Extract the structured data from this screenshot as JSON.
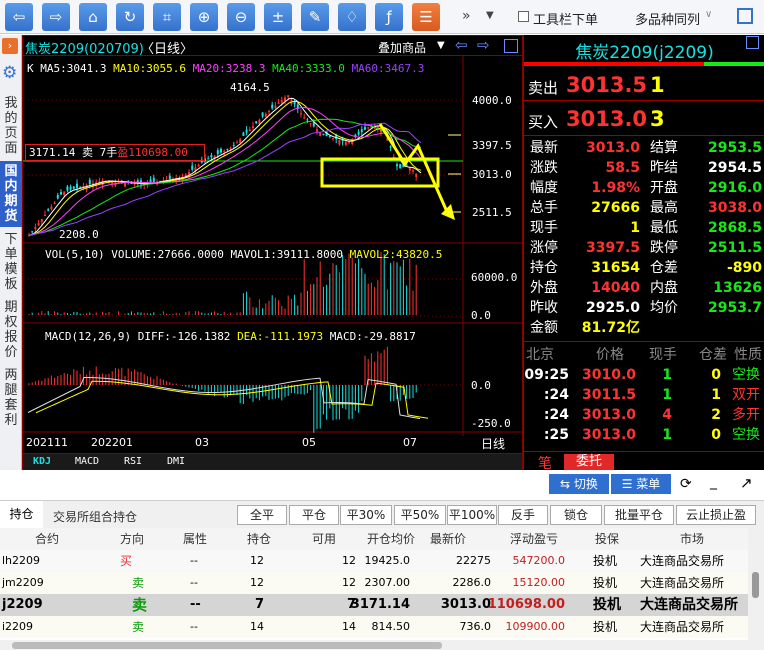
{
  "toolbar": {
    "icons": [
      "back",
      "forward",
      "home",
      "refresh",
      "crop",
      "zoom-in",
      "zoom-out",
      "calculator",
      "pencil",
      "bell",
      "formula",
      "list"
    ],
    "more": "»",
    "checkbox_label": "工具栏下单",
    "multi_label": "多品种同列"
  },
  "sidebar": {
    "items": [
      "我的页面",
      "国内期货",
      "下单模板",
      "期权报价",
      "两腿套利"
    ],
    "active": 1
  },
  "chart": {
    "title": "焦炭2209(020709)",
    "period": "〈日线〉",
    "overlay": "叠加商品",
    "ma_legend": {
      "k": "K",
      "ma5": "MA5:3041.3",
      "ma10": "MA10:3055.6",
      "ma20": "MA20:3238.3",
      "ma40": "MA40:3333.0",
      "ma60": "MA60:3467.3"
    },
    "high_label": "4164.5",
    "low_label": "2208.0",
    "position_box": {
      "price": "3171.14",
      "side": "卖",
      "qty": "7手",
      "pnl": "盈110698.00"
    },
    "price_axis": [
      "4000.0",
      "3397.5",
      "3013.0",
      "2511.5"
    ],
    "vol_legend": {
      "name": "VOL(5,10)",
      "volume": "VOLUME:27666.0000",
      "mavol1": "MAVOL1:39111.8000",
      "mavol2": "MAVOL2:43820.5"
    },
    "vol_axis": [
      "60000.0",
      "0.0"
    ],
    "macd_legend": {
      "name": "MACD(12,26,9)",
      "diff": "DIFF:-126.1382",
      "dea": "DEA:-111.1973",
      "macd": "MACD:-29.8817"
    },
    "macd_axis": [
      "0.0",
      "-250.0"
    ],
    "dates": [
      "202111",
      "202201",
      "03",
      "05",
      "07"
    ],
    "period_label": "日线",
    "indicator_tabs": [
      "KDJ",
      "MACD",
      "RSI",
      "DMI"
    ]
  },
  "quote": {
    "title": "焦炭2209(j2209)",
    "ask_label": "卖出",
    "ask_price": "3013.5",
    "ask_vol": "1",
    "bid_label": "买入",
    "bid_price": "3013.0",
    "bid_vol": "3",
    "rows": [
      [
        "最新",
        "3013.0",
        "结算",
        "2953.5"
      ],
      [
        "涨跌",
        "58.5",
        "昨结",
        "2954.5"
      ],
      [
        "幅度",
        "1.98%",
        "开盘",
        "2916.0"
      ],
      [
        "总手",
        "27666",
        "最高",
        "3038.0"
      ],
      [
        "现手",
        "1",
        "最低",
        "2868.5"
      ],
      [
        "涨停",
        "3397.5",
        "跌停",
        "2511.5"
      ],
      [
        "持仓",
        "31654",
        "仓差",
        "-890"
      ],
      [
        "外盘",
        "14040",
        "内盘",
        "13626"
      ],
      [
        "昨收",
        "2925.0",
        "均价",
        "2953.7"
      ],
      [
        "金额",
        "81.72亿",
        "",
        ""
      ]
    ],
    "tick_headers": [
      "北京",
      "价格",
      "现手",
      "仓差",
      "性质"
    ],
    "ticks": [
      [
        "09:25",
        "3010.0",
        "1",
        "0",
        "空换"
      ],
      [
        ":24",
        "3011.5",
        "1",
        "1",
        "双开"
      ],
      [
        ":24",
        "3013.0",
        "4",
        "2",
        "多开"
      ],
      [
        ":25",
        "3013.0",
        "1",
        "0",
        "空换"
      ]
    ],
    "tabs": [
      "笔",
      "委托"
    ]
  },
  "panel": {
    "switch": "切换",
    "menu": "菜单",
    "tabs": [
      "持仓",
      "交易所组合持仓"
    ],
    "actions": [
      "全平",
      "平仓",
      "平30%",
      "平50%",
      "平100%",
      "反手",
      "锁仓",
      "批量平仓",
      "云止损止盈"
    ],
    "headers": [
      "合约",
      "方向",
      "属性",
      "持仓",
      "可用",
      "开仓均价",
      "最新价",
      "浮动盈亏",
      "投保",
      "市场"
    ],
    "rows": [
      [
        "lh2209",
        "买",
        "--",
        "12",
        "12",
        "19425.0",
        "22275",
        "547200.0",
        "投机",
        "大连商品交易所"
      ],
      [
        "jm2209",
        "卖",
        "--",
        "12",
        "12",
        "2307.00",
        "2286.0",
        "15120.00",
        "投机",
        "大连商品交易所"
      ],
      [
        "j2209",
        "卖",
        "--",
        "7",
        "7",
        "3171.14",
        "3013.0",
        "110698.00",
        "投机",
        "大连商品交易所"
      ],
      [
        "i2209",
        "卖",
        "--",
        "14",
        "14",
        "814.50",
        "736.0",
        "109900.00",
        "投机",
        "大连商品交易所"
      ]
    ]
  },
  "colors": {
    "up": "#ff3232",
    "down": "#19e0e0",
    "accent": "#2f5fc8"
  }
}
